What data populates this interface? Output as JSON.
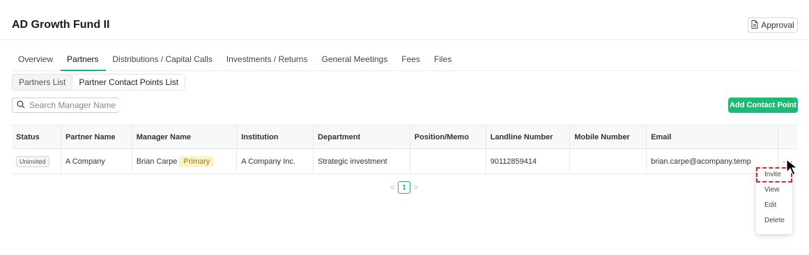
{
  "header": {
    "title": "AD Growth Fund II",
    "approval_label": "Approval"
  },
  "tabs": [
    {
      "label": "Overview"
    },
    {
      "label": "Partners"
    },
    {
      "label": "Distributions / Capital Calls"
    },
    {
      "label": "Investments / Returns"
    },
    {
      "label": "General Meetings"
    },
    {
      "label": "Fees"
    },
    {
      "label": "Files"
    }
  ],
  "active_tab": "Partners",
  "subtabs": [
    {
      "label": "Partners List"
    },
    {
      "label": "Partner Contact Points List"
    }
  ],
  "search": {
    "placeholder": "Search Manager Name",
    "value": ""
  },
  "add_button": "Add Contact Point",
  "table": {
    "headers": [
      "Status",
      "Partner Name",
      "Manager Name",
      "Institution",
      "Department",
      "Position/Memo",
      "Landline Number",
      "Mobile Number",
      "Email",
      ""
    ],
    "rows": [
      {
        "status": "Uninvited",
        "partner_name": "A Company",
        "manager_name": "Brian Carpe",
        "manager_tag": "Primary",
        "institution": "A Company Inc.",
        "department": "Strategic investment",
        "position": "",
        "landline": "90112859414",
        "mobile": "",
        "email": "brian.carpe@acompany.temp",
        "more": "···"
      }
    ]
  },
  "pagination": {
    "current": "1"
  },
  "context_menu": [
    "Invite",
    "View",
    "Edit",
    "Delete"
  ],
  "colors": {
    "accent": "#1dba74",
    "primary_badge_bg": "#fdf3c9",
    "highlight": "#d4282b"
  },
  "icons": [
    "document-icon",
    "search-icon",
    "chevron-left-icon",
    "chevron-right-icon",
    "more-icon",
    "mouse-pointer-icon"
  ]
}
